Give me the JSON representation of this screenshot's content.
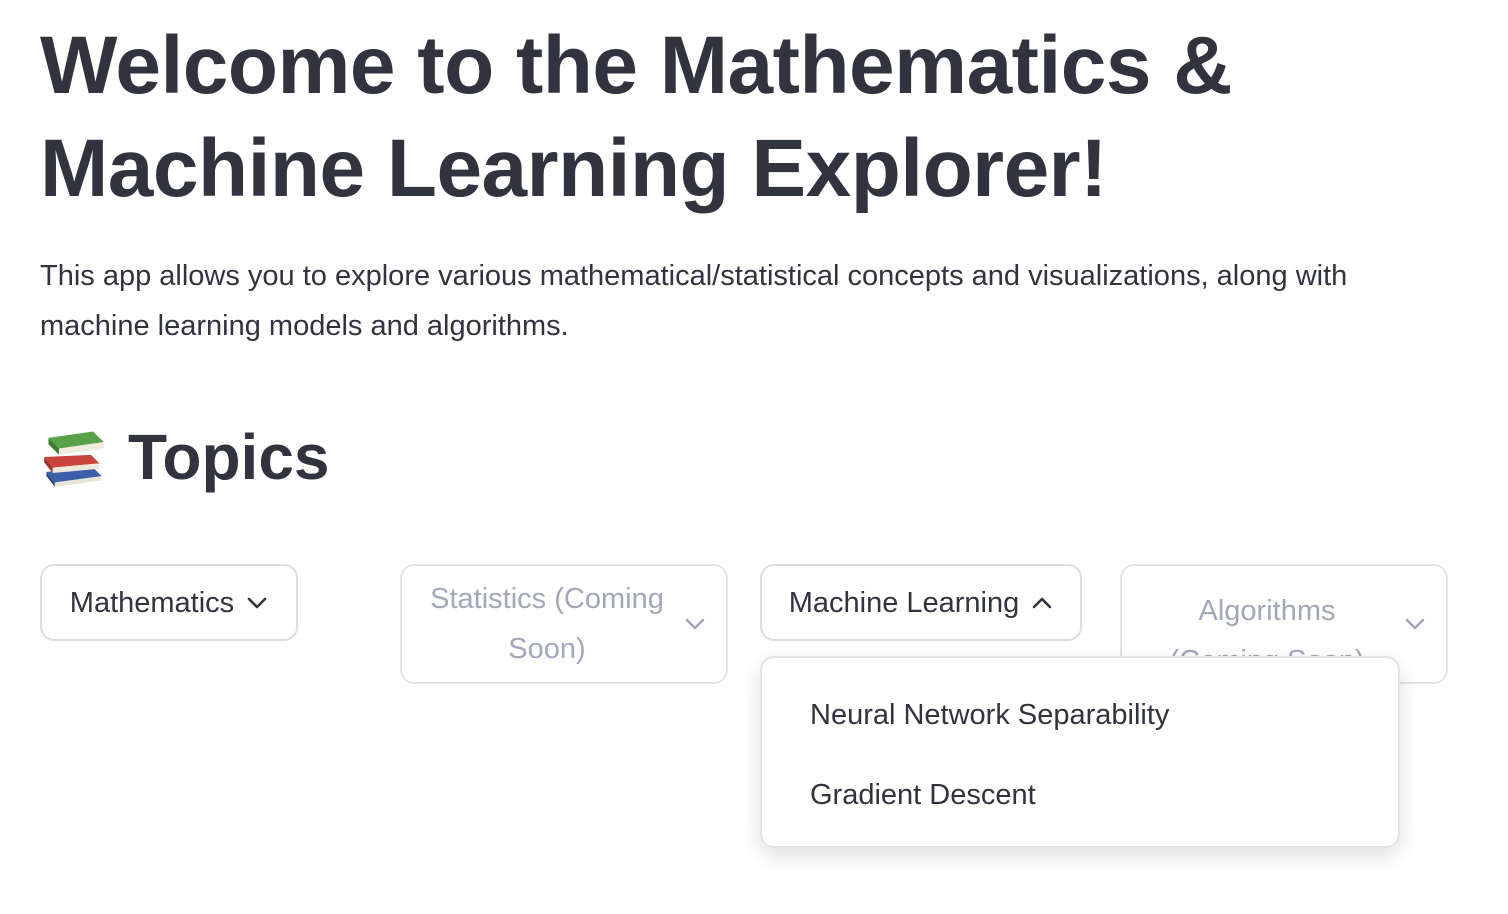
{
  "header": {
    "title": "Welcome to the Mathematics & Machine Learning Explorer!",
    "description": "This app allows you to explore various mathematical/statistical concepts and visualizations, along with machine learning models and algorithms."
  },
  "topics": {
    "icon": "books-icon",
    "heading": "Topics",
    "buttons": [
      {
        "label": "Mathematics",
        "state": "collapsed",
        "disabled": false
      },
      {
        "label": "Statistics (Coming Soon)",
        "state": "collapsed",
        "disabled": true
      },
      {
        "label": "Machine Learning",
        "state": "expanded",
        "disabled": false
      },
      {
        "label": "Algorithms (Coming Soon)",
        "state": "collapsed",
        "disabled": true
      }
    ],
    "ml_menu": {
      "items": [
        "Neural Network Separability",
        "Gradient Descent"
      ]
    }
  },
  "colors": {
    "text": "#31333f",
    "disabled_text": "#a3a8b8",
    "border": "#dcdde1",
    "background": "#ffffff"
  }
}
